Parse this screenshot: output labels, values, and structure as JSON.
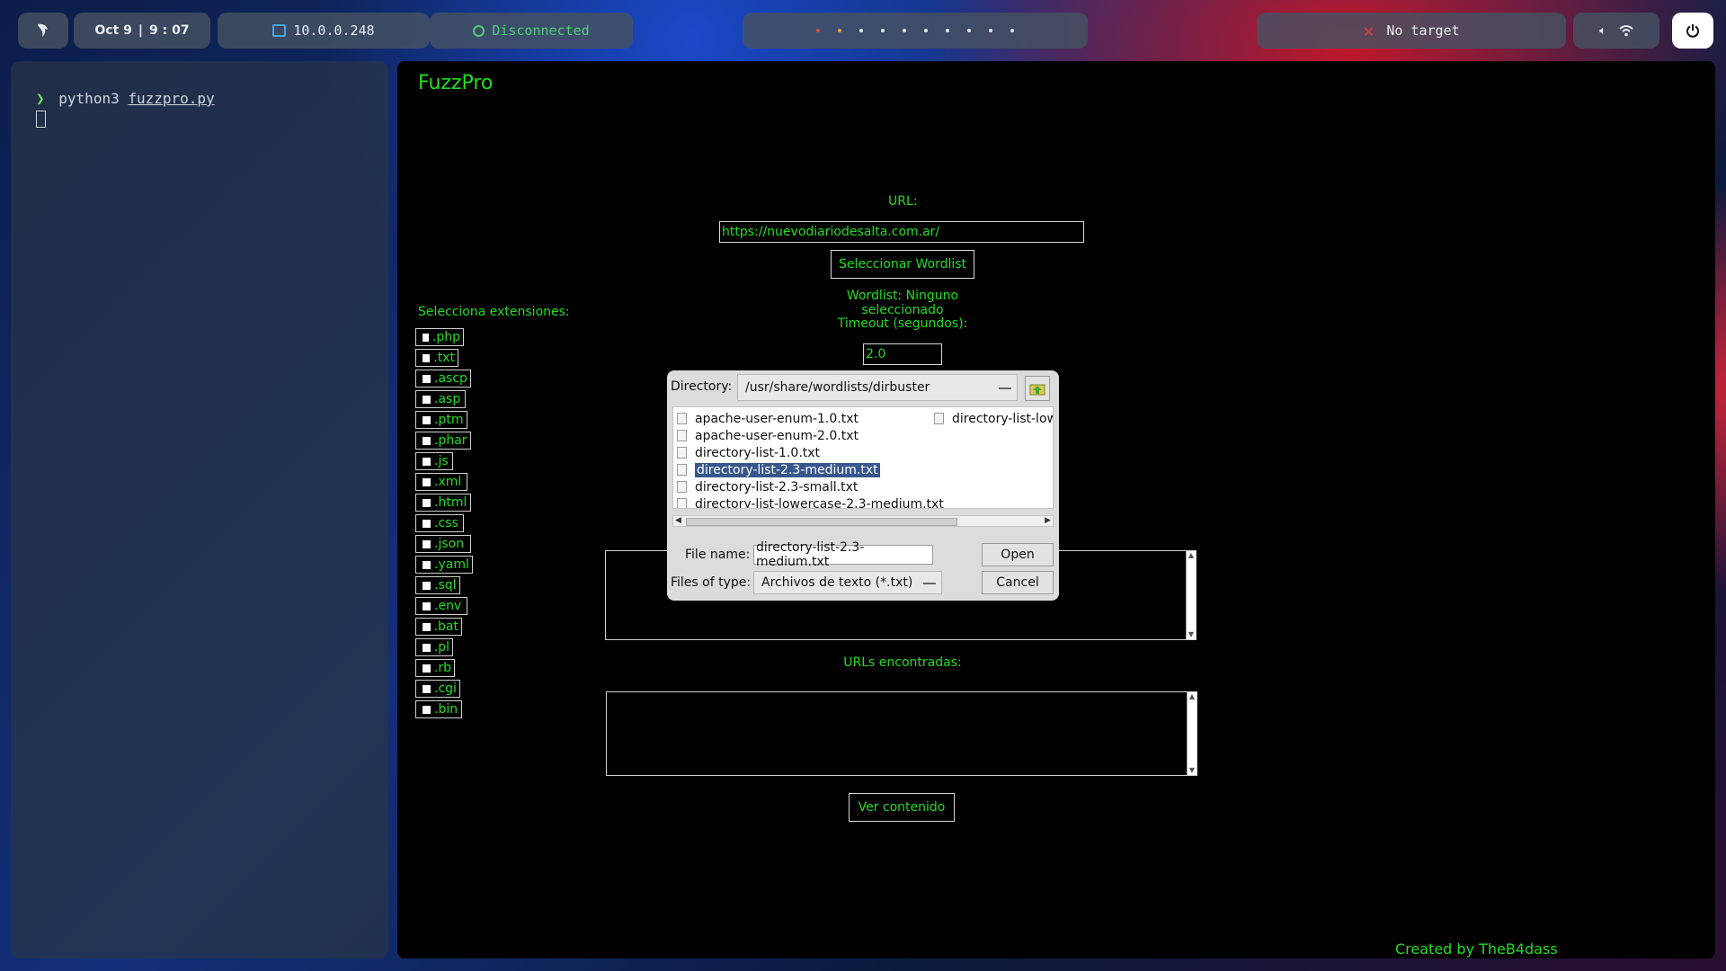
{
  "topbar": {
    "date": "Oct 9",
    "time": "9 : 07",
    "ip": "10.0.0.248",
    "vpn_status": "Disconnected",
    "target": "No target"
  },
  "terminal": {
    "prompt_symbol": "❯",
    "command": "python3",
    "argument": "fuzzpro.py"
  },
  "app": {
    "title": "FuzzPro",
    "url_label": "URL:",
    "url_value": "https://nuevodiariodesalta.com.ar/",
    "select_wordlist_button": "Seleccionar Wordlist",
    "wordlist_status": "Wordlist: Ninguno seleccionado",
    "timeout_label": "Timeout (segundos):",
    "timeout_value": "2.0",
    "extensions_label": "Selecciona extensiones:",
    "extensions": [
      ".php",
      ".txt",
      ".ascp",
      ".asp",
      ".ptm",
      ".phar",
      ".js",
      ".xml",
      ".html",
      ".css",
      ".json",
      ".yaml",
      ".sql",
      ".env",
      ".bat",
      ".pl",
      ".rb",
      ".cgi",
      ".bin"
    ],
    "found_urls_label": "URLs encontradas:",
    "view_content_button": "Ver contenido",
    "credits": "Created by TheB4dass"
  },
  "file_dialog": {
    "directory_label": "Directory:",
    "directory_value": "/usr/share/wordlists/dirbuster",
    "files": [
      "apache-user-enum-1.0.txt",
      "apache-user-enum-2.0.txt",
      "directory-list-1.0.txt",
      "directory-list-2.3-medium.txt",
      "directory-list-2.3-small.txt",
      "directory-list-lowercase-2.3-medium.txt"
    ],
    "files_col2": [
      "directory-list-lowe"
    ],
    "selected_file": "directory-list-2.3-medium.txt",
    "file_name_label": "File name:",
    "file_name_value": "directory-list-2.3-medium.txt",
    "file_type_label": "Files of type:",
    "file_type_value": "Archivos de texto (*.txt)",
    "open_button": "Open",
    "cancel_button": "Cancel"
  }
}
